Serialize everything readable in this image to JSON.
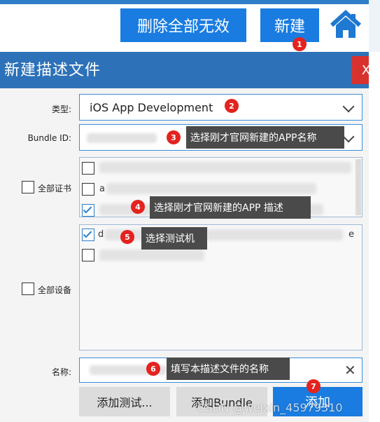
{
  "top_bar": {
    "delete_all_invalid_label": "删除全部无效",
    "new_label": "新建"
  },
  "dialog": {
    "title": "新建描述文件",
    "close_label": "X",
    "type_label": "类型:",
    "type_value": "iOS App Development",
    "bundle_id_label": "Bundle ID:",
    "all_certs_label": "全部证书",
    "all_devices_label": "全部设备",
    "name_label": "名称:",
    "clear_icon": "✕",
    "buttons": {
      "add_test": "添加测试...",
      "add_bundle": "添加Bundle",
      "add": "添加"
    }
  },
  "annotations": [
    {
      "num": "1"
    },
    {
      "num": "2"
    },
    {
      "num": "3",
      "text": "选择刚才官网新建的APP名称"
    },
    {
      "num": "4",
      "text": "选择刚才官网新建的APP 描述"
    },
    {
      "num": "5",
      "text": "选择测试机"
    },
    {
      "num": "6",
      "text": "填写本描述文件的名称"
    },
    {
      "num": "7"
    }
  ],
  "cert_list": {
    "items": [
      {
        "checked": false,
        "text": ""
      },
      {
        "checked": false,
        "text": "a"
      },
      {
        "checked": true,
        "text": ""
      }
    ]
  },
  "device_list": {
    "items": [
      {
        "checked": true,
        "text": "d",
        "suffix": "e"
      },
      {
        "checked": false,
        "text": ""
      }
    ]
  },
  "watermark": "CSDN @weixin_45979310",
  "colors": {
    "accent_blue": "#1a7ce0",
    "title_bar": "#2d72b8",
    "close_red": "#d9322e",
    "badge_red": "#e3231f"
  }
}
